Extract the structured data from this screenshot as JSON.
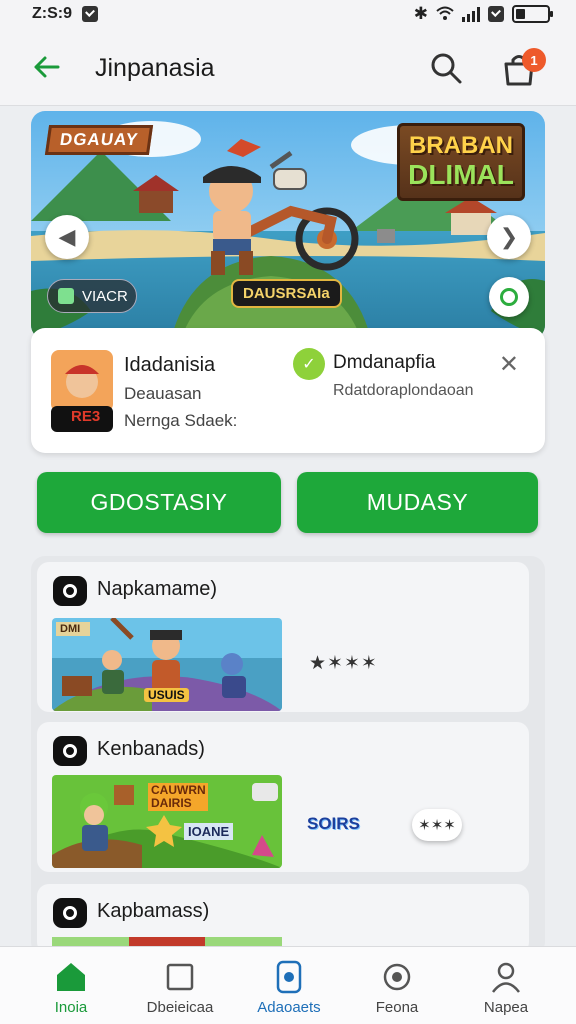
{
  "status_bar": {
    "time": "Z:S:9",
    "icons": [
      "check-icon",
      "bluetooth-icon",
      "wifi-icon",
      "signal-icon",
      "battery-icon"
    ]
  },
  "app_bar": {
    "title": "Jinpanasia",
    "back_icon": "arrow-left-icon",
    "search_icon": "search-icon",
    "bag_icon": "shopping-bag-icon",
    "badge_count": "1"
  },
  "hero": {
    "tag": "DGAUAY",
    "title_line1": "BRABAN",
    "title_line2": "DLIMAL",
    "caption": "DAUSRSAIa",
    "pill_label": "VIACR",
    "colors": {
      "accent": "#1ea83a",
      "sky": "#7ec6ee",
      "sea": "#4aa7c9"
    }
  },
  "info": {
    "name": "Idadanisia",
    "subtitle": "Deauasan",
    "subtitle2": "Nernga Sdaek:",
    "badge_label": "RE3",
    "name2": "Dmdanapfia",
    "subtitle3": "Rdatdoraplondaoan",
    "close_icon": "close-icon"
  },
  "buttons": {
    "primary": "GDOSTASIY",
    "secondary": "MUDASY"
  },
  "sections": [
    {
      "title": "Napkamame)",
      "thumb_tag": "DMI",
      "thumb_caption": "USUIS",
      "rating": "★✶✶✶"
    },
    {
      "title": "Kenbanads)",
      "thumb_title": "CAUWRN DAIRIS",
      "thumb_caption": "IOANE",
      "logo": "SOIRS",
      "chip": "✶✶✶"
    },
    {
      "title": "Kapbamass)"
    }
  ],
  "bottom_nav": [
    {
      "label": "Inoia",
      "icon": "home-icon"
    },
    {
      "label": "Dbeieicaa",
      "icon": "square-icon"
    },
    {
      "label": "Adaoaets",
      "icon": "device-icon"
    },
    {
      "label": "Feona",
      "icon": "rotate-icon"
    },
    {
      "label": "Napea",
      "icon": "profile-icon"
    }
  ]
}
